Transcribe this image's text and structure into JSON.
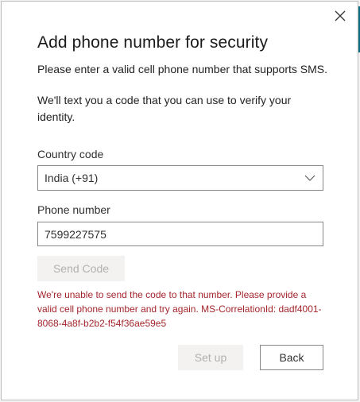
{
  "dialog": {
    "title": "Add phone number for security",
    "description": "Please enter a valid cell phone number that supports SMS.",
    "note": "We'll text you a code that you can use to verify your identity.",
    "country_code": {
      "label": "Country code",
      "selected": "India (+91)"
    },
    "phone": {
      "label": "Phone number",
      "value": "7599227575"
    },
    "send_code_label": "Send Code",
    "error_message": "We're unable to send the code to that number. Please provide a valid cell phone number and try again. MS-CorrelationId: dadf4001-8068-4a8f-b2b2-f54f36ae59e5",
    "setup_label": "Set up",
    "back_label": "Back",
    "close_icon": "close-icon"
  },
  "colors": {
    "error": "#a4262c",
    "accent": "#0f6e7e",
    "disabled_bg": "#f3f2f1",
    "disabled_text": "#b3b0ad"
  }
}
